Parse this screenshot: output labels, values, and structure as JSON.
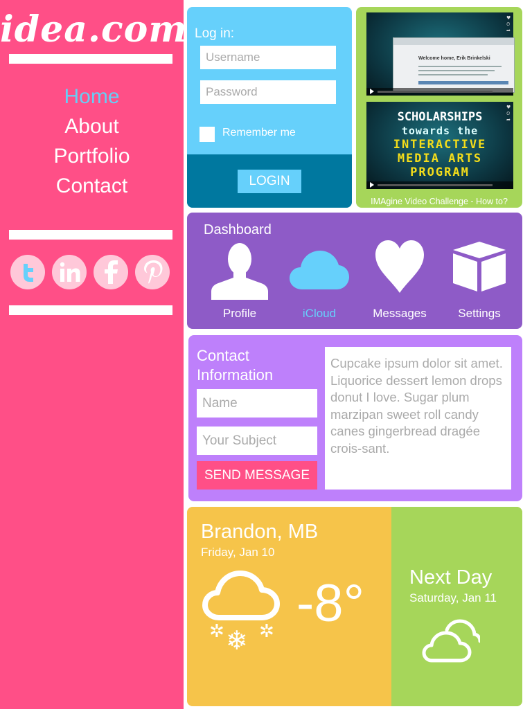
{
  "brand": {
    "logo": "idea.com",
    "primary": "#ff4f87",
    "accent": "#66d0fb"
  },
  "nav": {
    "items": [
      {
        "label": "Home",
        "active": true
      },
      {
        "label": "About",
        "active": false
      },
      {
        "label": "Portfolio",
        "active": false
      },
      {
        "label": "Contact",
        "active": false
      }
    ]
  },
  "social": [
    "twitter-icon",
    "linkedin-icon",
    "facebook-icon",
    "pinterest-icon"
  ],
  "login": {
    "title": "Log in:",
    "username_placeholder": "Username",
    "password_placeholder": "Password",
    "remember_label": "Remember me",
    "button_label": "LOGIN"
  },
  "video": {
    "thumb1": {
      "heading": "Welcome home, Erik Brinkelski"
    },
    "thumb2": {
      "line1": "SCHOLARSHIPS",
      "line2": "towards the",
      "line3": "INTERACTIVE",
      "line4": "MEDIA ARTS",
      "line5": "PROGRAM"
    },
    "caption": "IMAgine Video Challenge - How to?"
  },
  "dashboard": {
    "title": "Dashboard",
    "items": [
      {
        "label": "Profile",
        "icon": "person-icon",
        "active": false
      },
      {
        "label": "iCloud",
        "icon": "cloud-icon",
        "active": true
      },
      {
        "label": "Messages",
        "icon": "heart-icon",
        "active": false
      },
      {
        "label": "Settings",
        "icon": "box-icon",
        "active": false
      }
    ]
  },
  "contact": {
    "title": "Contact Information",
    "name_placeholder": "Name",
    "subject_placeholder": "Your Subject",
    "send_label": "SEND MESSAGE",
    "message": "Cupcake ipsum dolor sit amet. Liquorice dessert lemon drops donut I love. Sugar plum marzipan sweet roll candy canes gingerbread dragée crois-sant."
  },
  "weather": {
    "city": "Brandon, MB",
    "date": "Friday, Jan 10",
    "temperature": "-8°",
    "today_icon": "snow-cloud-icon",
    "next_title": "Next Day",
    "next_date": "Saturday, Jan 11",
    "next_icon": "cloudy-icon"
  }
}
